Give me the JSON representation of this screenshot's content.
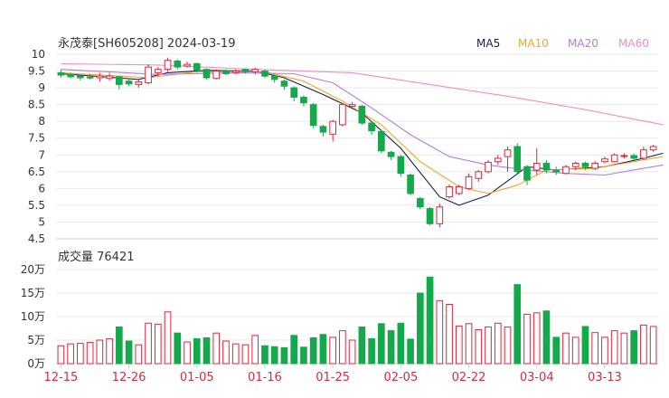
{
  "title": "永茂泰[SH605208] 2024-03-19",
  "legend": [
    {
      "name": "MA5",
      "color": "#1a1a4e"
    },
    {
      "name": "MA10",
      "color": "#f5a623"
    },
    {
      "name": "MA20",
      "color": "#b57bdf"
    },
    {
      "name": "MA60",
      "color": "#f08ec8"
    }
  ],
  "colors": {
    "up": "#e0263c",
    "down": "#14a94a",
    "grid": "#e8e8e8",
    "axis": "#cccccc",
    "text": "#333333",
    "date": "#e0263c"
  },
  "chart_data": [
    {
      "type": "candlestick",
      "title": "永茂泰[SH605208] 2024-03-19",
      "ylim": [
        4.5,
        10
      ],
      "yticks": [
        "10",
        "9.5",
        "9",
        "8.5",
        "8",
        "7.5",
        "7",
        "6.5",
        "6",
        "5.5",
        "5",
        "4.5"
      ],
      "xticks": [
        "12-15",
        "12-26",
        "01-05",
        "01-16",
        "01-25",
        "02-05",
        "02-22",
        "03-04",
        "03-13"
      ],
      "xtick_index": [
        0,
        7,
        14,
        21,
        28,
        35,
        42,
        49,
        56
      ],
      "candles": [
        [
          9.45,
          9.38,
          9.55,
          9.3
        ],
        [
          9.4,
          9.33,
          9.45,
          9.28
        ],
        [
          9.35,
          9.3,
          9.4,
          9.22
        ],
        [
          9.32,
          9.3,
          9.42,
          9.25
        ],
        [
          9.3,
          9.35,
          9.45,
          9.18
        ],
        [
          9.28,
          9.35,
          9.45,
          9.22
        ],
        [
          9.33,
          9.1,
          9.35,
          8.95
        ],
        [
          9.2,
          9.12,
          9.25,
          9.05
        ],
        [
          9.1,
          9.18,
          9.25,
          9.0
        ],
        [
          9.15,
          9.62,
          9.7,
          9.1
        ],
        [
          9.45,
          9.55,
          9.62,
          9.35
        ],
        [
          9.55,
          9.82,
          9.9,
          9.48
        ],
        [
          9.8,
          9.62,
          9.85,
          9.55
        ],
        [
          9.65,
          9.7,
          9.78,
          9.6
        ],
        [
          9.72,
          9.52,
          9.75,
          9.45
        ],
        [
          9.55,
          9.3,
          9.58,
          9.25
        ],
        [
          9.28,
          9.5,
          9.55,
          9.25
        ],
        [
          9.5,
          9.42,
          9.55,
          9.38
        ],
        [
          9.45,
          9.5,
          9.55,
          9.4
        ],
        [
          9.55,
          9.48,
          9.58,
          9.42
        ],
        [
          9.48,
          9.55,
          9.6,
          9.4
        ],
        [
          9.5,
          9.35,
          9.55,
          9.3
        ],
        [
          9.35,
          9.25,
          9.4,
          9.15
        ],
        [
          9.2,
          9.05,
          9.25,
          8.95
        ],
        [
          9.0,
          8.72,
          9.05,
          8.6
        ],
        [
          8.72,
          8.55,
          8.78,
          8.45
        ],
        [
          8.5,
          7.88,
          8.55,
          7.8
        ],
        [
          7.85,
          7.68,
          7.9,
          7.55
        ],
        [
          7.62,
          8.0,
          8.05,
          7.4
        ],
        [
          7.9,
          8.5,
          8.55,
          7.85
        ],
        [
          8.45,
          8.5,
          8.58,
          8.4
        ],
        [
          8.45,
          7.95,
          8.5,
          7.9
        ],
        [
          7.95,
          7.72,
          8.0,
          7.6
        ],
        [
          7.7,
          7.12,
          7.75,
          7.05
        ],
        [
          7.08,
          6.95,
          7.12,
          6.85
        ],
        [
          6.95,
          6.45,
          7.0,
          6.35
        ],
        [
          6.4,
          5.85,
          6.45,
          5.8
        ],
        [
          5.7,
          5.45,
          5.75,
          5.38
        ],
        [
          5.4,
          4.95,
          5.45,
          4.9
        ],
        [
          4.95,
          5.45,
          5.55,
          4.85
        ],
        [
          5.75,
          6.05,
          6.12,
          5.7
        ],
        [
          5.85,
          6.05,
          6.12,
          5.8
        ],
        [
          6.0,
          6.35,
          6.45,
          5.95
        ],
        [
          6.3,
          6.5,
          6.55,
          6.2
        ],
        [
          6.5,
          6.78,
          6.85,
          6.45
        ],
        [
          6.8,
          6.9,
          7.0,
          6.7
        ],
        [
          6.95,
          7.15,
          7.25,
          6.5
        ],
        [
          7.25,
          6.5,
          7.35,
          6.4
        ],
        [
          6.65,
          6.25,
          6.7,
          6.1
        ],
        [
          6.55,
          6.75,
          7.2,
          6.4
        ],
        [
          6.75,
          6.55,
          6.85,
          6.45
        ],
        [
          6.55,
          6.5,
          6.65,
          6.4
        ],
        [
          6.45,
          6.65,
          6.7,
          6.42
        ],
        [
          6.65,
          6.75,
          6.8,
          6.55
        ],
        [
          6.75,
          6.65,
          6.8,
          6.55
        ],
        [
          6.6,
          6.75,
          6.82,
          6.55
        ],
        [
          6.8,
          6.88,
          6.95,
          6.75
        ],
        [
          6.8,
          7.0,
          7.05,
          6.78
        ],
        [
          6.98,
          6.98,
          7.05,
          6.9
        ],
        [
          6.98,
          6.9,
          7.05,
          6.85
        ],
        [
          6.9,
          7.15,
          7.25,
          6.85
        ],
        [
          7.15,
          7.25,
          7.3,
          7.1
        ]
      ],
      "ma": {
        "MA5": [
          [
            0,
            9.42
          ],
          [
            8,
            9.25
          ],
          [
            11,
            9.45
          ],
          [
            15,
            9.52
          ],
          [
            20,
            9.5
          ],
          [
            23,
            9.3
          ],
          [
            27,
            8.8
          ],
          [
            31,
            8.25
          ],
          [
            35,
            7.2
          ],
          [
            39,
            5.75
          ],
          [
            41,
            5.5
          ],
          [
            44,
            5.8
          ],
          [
            48,
            6.65
          ],
          [
            51,
            6.55
          ],
          [
            56,
            6.65
          ],
          [
            60,
            6.9
          ],
          [
            62,
            7.05
          ]
        ],
        "MA10": [
          [
            0,
            9.45
          ],
          [
            9,
            9.3
          ],
          [
            14,
            9.48
          ],
          [
            21,
            9.48
          ],
          [
            25,
            9.2
          ],
          [
            29,
            8.6
          ],
          [
            33,
            7.9
          ],
          [
            37,
            6.8
          ],
          [
            41,
            6.05
          ],
          [
            44,
            5.85
          ],
          [
            47,
            6.1
          ],
          [
            50,
            6.55
          ],
          [
            55,
            6.6
          ],
          [
            60,
            6.85
          ],
          [
            62,
            6.95
          ]
        ],
        "MA20": [
          [
            0,
            9.55
          ],
          [
            10,
            9.4
          ],
          [
            18,
            9.45
          ],
          [
            24,
            9.42
          ],
          [
            28,
            9.15
          ],
          [
            32,
            8.4
          ],
          [
            36,
            7.6
          ],
          [
            40,
            6.95
          ],
          [
            44,
            6.7
          ],
          [
            48,
            6.55
          ],
          [
            52,
            6.45
          ],
          [
            56,
            6.4
          ],
          [
            60,
            6.6
          ],
          [
            62,
            6.7
          ]
        ],
        "MA60": [
          [
            0,
            9.72
          ],
          [
            10,
            9.68
          ],
          [
            20,
            9.55
          ],
          [
            30,
            9.45
          ],
          [
            38,
            9.1
          ],
          [
            46,
            8.75
          ],
          [
            54,
            8.35
          ],
          [
            62,
            7.9
          ]
        ]
      }
    },
    {
      "type": "bar",
      "title": "成交量 76421",
      "ylim": [
        0,
        20
      ],
      "yticks": [
        "20万",
        "15万",
        "10万",
        "5万",
        "0万"
      ],
      "values": [
        3.8,
        4.2,
        4.3,
        4.5,
        5.0,
        5.3,
        7.8,
        4.8,
        4.0,
        8.6,
        8.4,
        11.0,
        6.5,
        4.6,
        5.3,
        5.5,
        6.5,
        4.8,
        4.2,
        4.0,
        6.0,
        3.8,
        3.6,
        3.4,
        6.0,
        3.5,
        5.5,
        6.2,
        5.6,
        7.0,
        5.0,
        7.8,
        5.3,
        8.5,
        7.0,
        8.6,
        5.2,
        15.0,
        18.4,
        13.4,
        12.6,
        8.0,
        8.5,
        7.2,
        7.8,
        8.6,
        7.8,
        16.8,
        10.5,
        10.8,
        11.2,
        5.6,
        6.5,
        5.6,
        7.9,
        6.6,
        5.6,
        7.0,
        6.5,
        7.0,
        8.2,
        7.9
      ],
      "up": [
        1,
        1,
        1,
        1,
        1,
        1,
        0,
        0,
        1,
        1,
        1,
        1,
        0,
        1,
        0,
        0,
        1,
        1,
        1,
        1,
        1,
        0,
        0,
        0,
        0,
        0,
        0,
        0,
        1,
        1,
        1,
        0,
        0,
        0,
        0,
        0,
        0,
        0,
        0,
        1,
        1,
        1,
        1,
        1,
        1,
        1,
        1,
        0,
        1,
        1,
        0,
        0,
        1,
        1,
        0,
        1,
        1,
        1,
        1,
        0,
        1,
        1
      ],
      "last": "76421"
    }
  ]
}
